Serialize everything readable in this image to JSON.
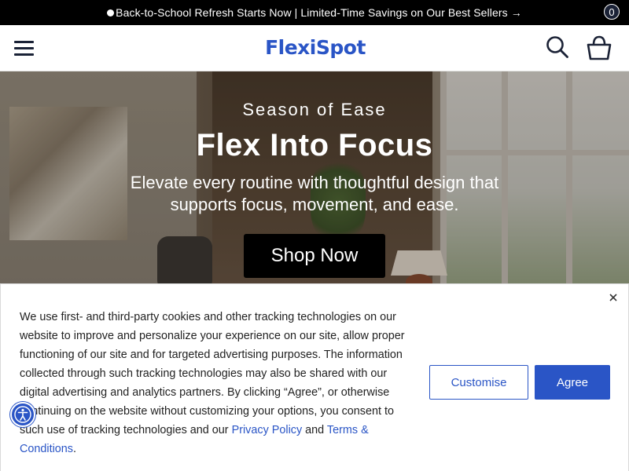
{
  "announcement": {
    "text": "Back-to-School Refresh Starts Now | Limited-Time Savings on Our Best Sellers",
    "arrow": "→",
    "icon": "dot-icon"
  },
  "header": {
    "logo_text": "FlexiSpot",
    "menu_icon": "hamburger-menu-icon",
    "search_icon": "search-icon",
    "cart_icon": "shopping-bag-icon",
    "cart_count": "0"
  },
  "hero": {
    "eyebrow": "Season of Ease",
    "title": "Flex Into Focus",
    "subtitle": "Elevate every routine with thoughtful design that supports focus, movement, and ease.",
    "cta_label": "Shop Now"
  },
  "cookie_banner": {
    "text_before": "We use first- and third-party cookies and other tracking technologies on our website to improve and personalize your experience on our site, allow proper functioning of our site and for targeted advertising purposes. The information collected through such tracking technologies may also be shared with our digital advertising and analytics partners. By clicking “Agree”, or otherwise continuing on the website without customizing your options, you consent to such use of tracking technologies and our ",
    "privacy_link": "Privacy Policy",
    "conjunction": " and ",
    "terms_link": "Terms & Conditions",
    "text_after": ".",
    "customise_label": "Customise",
    "agree_label": "Agree",
    "close_icon": "close-icon"
  },
  "accessibility": {
    "icon": "accessibility-icon"
  },
  "colors": {
    "brand_blue": "#2a55c6",
    "announcement_bg": "#000000",
    "cta_bg": "#000000"
  }
}
